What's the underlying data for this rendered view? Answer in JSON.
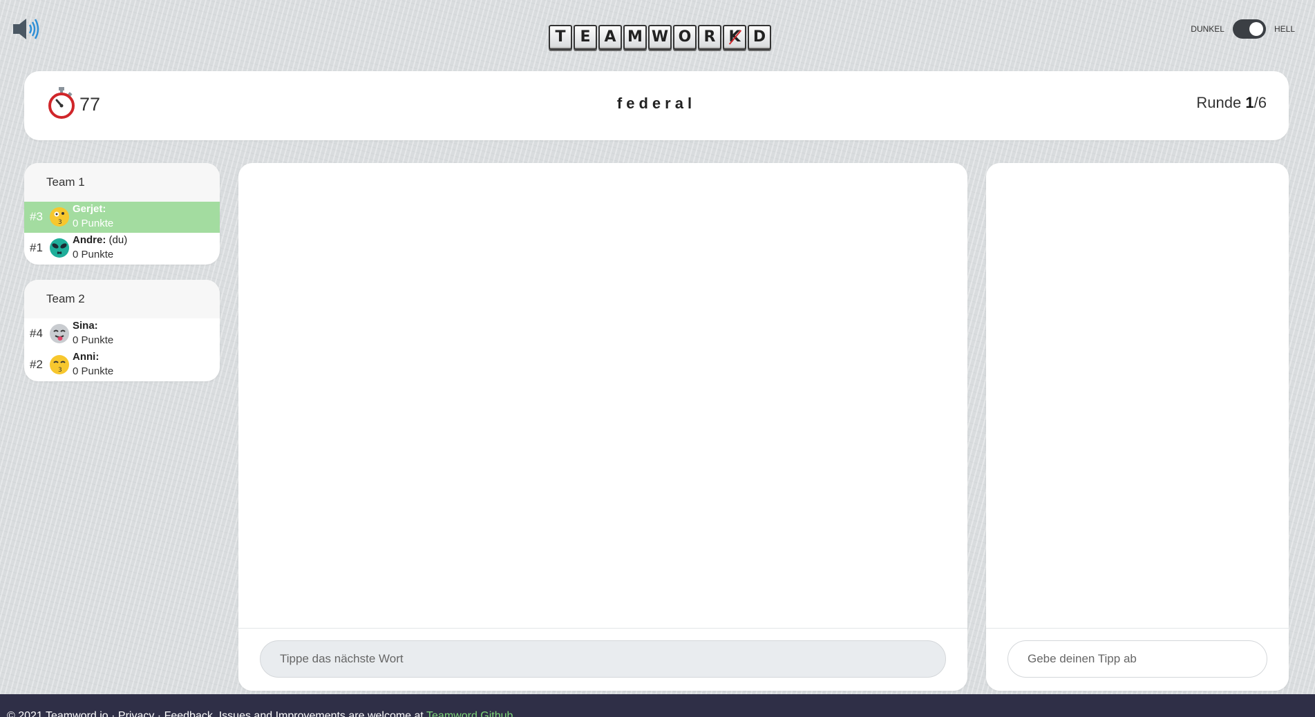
{
  "top_bar": {
    "speaker_icon": "speaker-volume-icon",
    "logo_letters": [
      "T",
      "E",
      "A",
      "M",
      "W",
      "O",
      "R",
      "K",
      "D"
    ],
    "logo_crossed_letter": "K",
    "theme_dark_label": "DUNKEL",
    "theme_light_label": "HELL",
    "theme_selected": "HELL"
  },
  "header": {
    "timer_icon": "stopwatch-icon",
    "timer_value": "77",
    "word": "federal",
    "round_label": "Runde",
    "round_current": "1",
    "round_separator": "/",
    "round_total": "6"
  },
  "teams": [
    {
      "name": "Team 1",
      "players": [
        {
          "rank": "#3",
          "name": "Gerjet:",
          "you": "",
          "score": "0 Punkte",
          "active": true,
          "avatar": "kissing-wink-emoji-icon"
        },
        {
          "rank": "#1",
          "name": "Andre:",
          "you": " (du)",
          "score": "0 Punkte",
          "active": false,
          "avatar": "alien-emoji-icon"
        }
      ]
    },
    {
      "name": "Team 2",
      "players": [
        {
          "rank": "#4",
          "name": "Sina:",
          "you": "",
          "score": "0 Punkte",
          "active": false,
          "avatar": "tongue-out-emoji-icon"
        },
        {
          "rank": "#2",
          "name": "Anni:",
          "you": "",
          "score": "0 Punkte",
          "active": false,
          "avatar": "kissing-smile-emoji-icon"
        }
      ]
    }
  ],
  "main": {
    "word_input_placeholder": "Tippe das nächste Wort",
    "guess_input_placeholder": "Gebe deinen Tipp ab"
  },
  "footer": {
    "copyright": "© 2021 Teamword.io",
    "sep": " · ",
    "privacy": "Privacy",
    "feedback_text": "Feedback, Issues and Improvements are welcome at ",
    "github_link": "Teamword Github"
  },
  "colors": {
    "active_player_bg": "#a3dca0",
    "footer_bg": "#2f2f47",
    "github_link": "#7fd67a",
    "timer_red": "#d0262a"
  }
}
